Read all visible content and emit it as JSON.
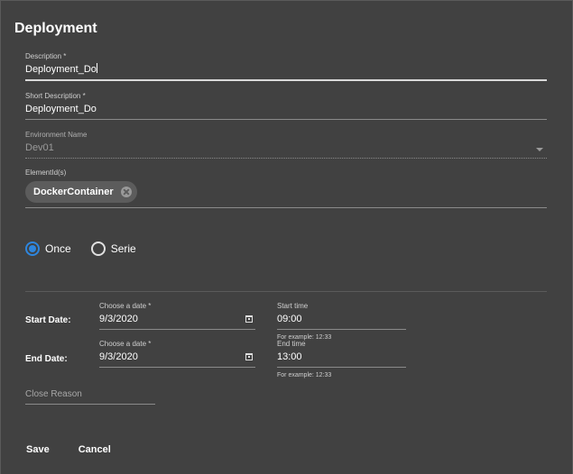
{
  "dialog": {
    "title": "Deployment"
  },
  "form": {
    "description": {
      "label": "Description *",
      "value": "Deployment_Do"
    },
    "short_description": {
      "label": "Short Description *",
      "value": "Deployment_Do"
    },
    "environment": {
      "label": "Environment Name",
      "value": "Dev01"
    },
    "element_ids": {
      "label": "ElementId(s)",
      "chips": [
        "DockerContainer"
      ]
    },
    "schedule": {
      "options": [
        {
          "label": "Once",
          "checked": true
        },
        {
          "label": "Serie",
          "checked": false
        }
      ]
    },
    "start": {
      "row_label": "Start Date:",
      "date_label": "Choose a date *",
      "date_value": "9/3/2020",
      "time_label": "Start time",
      "time_value": "09:00",
      "time_hint": "For example: 12:33"
    },
    "end": {
      "row_label": "End Date:",
      "date_label": "Choose a date *",
      "date_value": "9/3/2020",
      "time_label": "End time",
      "time_value": "13:00",
      "time_hint": "For example: 12:33"
    },
    "close_reason": {
      "placeholder": "Close Reason"
    }
  },
  "actions": {
    "save": "Save",
    "cancel": "Cancel"
  },
  "colors": {
    "background": "#414141",
    "accent": "#2e86de"
  },
  "icons": {
    "calendar": "calendar-icon",
    "chip_remove": "close-circle-icon",
    "dropdown": "chevron-down-icon"
  }
}
